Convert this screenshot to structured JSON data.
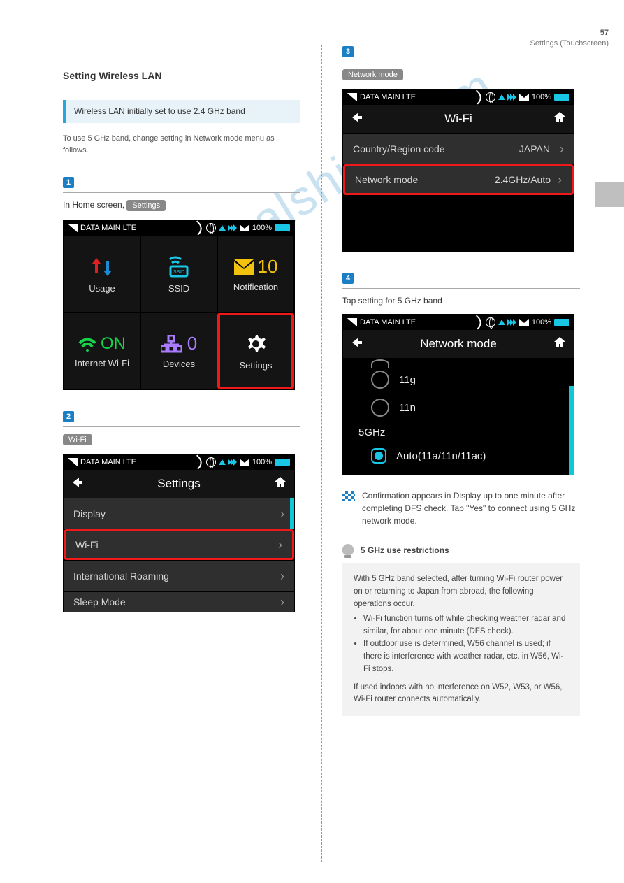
{
  "page": {
    "number": "57",
    "section_label": "Settings (Touchscreen)"
  },
  "watermark": "manualshive.com",
  "left": {
    "section_title": "Setting Wireless LAN",
    "note_heading": "Wireless LAN initially set to use 2.4 GHz band",
    "note_body": "To use 5 GHz band, change setting in Network mode menu as follows.",
    "step1": {
      "num": "1",
      "instr_prefix": "In Home screen,",
      "tag": "Settings"
    },
    "step2": {
      "num": "2",
      "tag": "Wi-Fi"
    }
  },
  "right": {
    "step3": {
      "num": "3",
      "tag": "Network mode"
    },
    "step4": {
      "num": "4",
      "instr": "Tap setting for 5 GHz band"
    }
  },
  "statusbar": {
    "carrier": "DATA MAIN LTE",
    "battery": "100%"
  },
  "home": {
    "cells": [
      {
        "label": "Usage"
      },
      {
        "label": "SSID",
        "badge": "SSID"
      },
      {
        "label": "Notification",
        "count": "10"
      },
      {
        "label": "Internet Wi-Fi",
        "status": "ON"
      },
      {
        "label": "Devices",
        "count": "0"
      },
      {
        "label": "Settings"
      }
    ]
  },
  "settings_screen": {
    "title": "Settings",
    "items": [
      "Display",
      "Wi-Fi",
      "International Roaming",
      "Sleep Mode"
    ]
  },
  "wifi_screen": {
    "title": "Wi-Fi",
    "row1_label": "Country/Region code",
    "row1_value": "JAPAN",
    "row2_label": "Network mode",
    "row2_value": "2.4GHz/Auto"
  },
  "mode_screen": {
    "title": "Network mode",
    "opt1": "11g",
    "opt2": "11n",
    "cat": "5GHz",
    "opt3": "Auto(11a/11n/11ac)"
  },
  "flag_text": "Confirmation appears in Display up to one minute after completing DFS check. Tap \"Yes\" to connect using 5 GHz network mode.",
  "tip_heading": "5 GHz use restrictions",
  "tip_text": "With 5 GHz band selected, after turning Wi-Fi router power on or returning to Japan from abroad, the following operations occur.",
  "tip_b1": "Wi-Fi function turns off while checking weather radar and similar, for about one minute (DFS check).",
  "tip_b2": "If outdoor use is determined, W56 channel is used; if there is interference with weather radar, etc. in W56, Wi-Fi stops.",
  "tip_tail": "If used indoors with no interference on W52, W53, or W56, Wi-Fi router connects automatically."
}
